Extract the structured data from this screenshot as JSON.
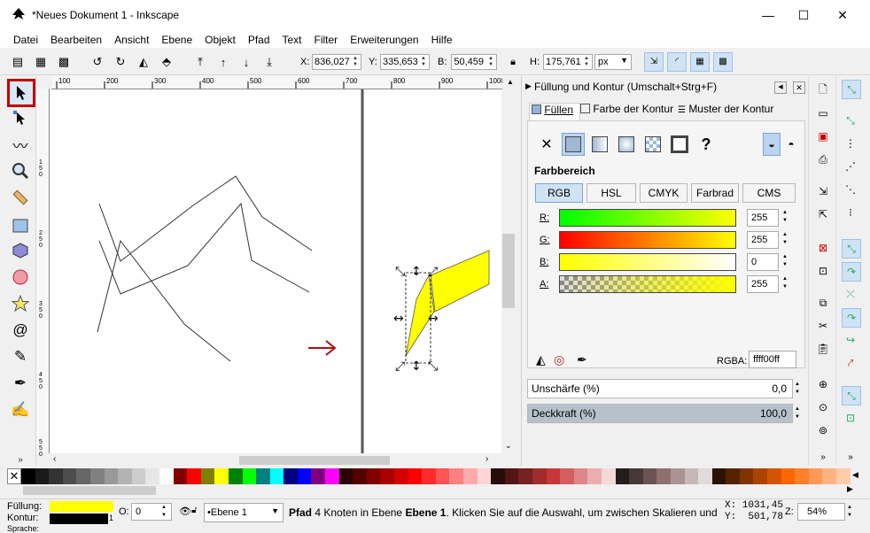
{
  "window": {
    "title": "*Neues Dokument 1 - Inkscape",
    "app_icon": "inkscape-logo-icon",
    "minimize": "—",
    "maximize": "☐",
    "close": "✕"
  },
  "menu": [
    "Datei",
    "Bearbeiten",
    "Ansicht",
    "Ebene",
    "Objekt",
    "Pfad",
    "Text",
    "Filter",
    "Erweiterungen",
    "Hilfe"
  ],
  "toolbar": {
    "x_label": "X:",
    "x_value": "836,027",
    "y_label": "Y:",
    "y_value": "335,653",
    "w_label": "B:",
    "w_value": "50,459",
    "h_label": "H:",
    "h_value": "175,761",
    "unit": "px"
  },
  "tools": [
    "selector-tool-icon",
    "node-tool-icon",
    "tweak-tool-icon",
    "zoom-tool-icon",
    "measure-tool-icon",
    "rect-tool-icon",
    "box3d-tool-icon",
    "ellipse-tool-icon",
    "star-tool-icon",
    "spiral-tool-icon",
    "pencil-tool-icon",
    "pen-tool-icon",
    "calligraphy-tool-icon"
  ],
  "ruler": {
    "h_ticks": [
      "100",
      "200",
      "300",
      "400",
      "500",
      "600",
      "700",
      "800",
      "900",
      "1000"
    ],
    "v_ticks": [
      "1\n5\n0",
      "2\n5\n0",
      "3\n5\n0",
      "4\n5\n0",
      "5\n5\n0"
    ]
  },
  "panel": {
    "title": "Füllung und Kontur (Umschalt+Strg+F)",
    "tabs": [
      "Füllen",
      "Farbe der Kontur",
      "Muster der Kontur"
    ],
    "section": "Farbbereich",
    "modes": [
      "RGB",
      "HSL",
      "CMYK",
      "Farbrad",
      "CMS"
    ],
    "channels": [
      {
        "label": "R:",
        "value": "255"
      },
      {
        "label": "G:",
        "value": "255"
      },
      {
        "label": "B:",
        "value": "0"
      },
      {
        "label": "A:",
        "value": "255"
      }
    ],
    "rgba_label": "RGBA:",
    "rgba_value": "ffff00ff",
    "blur_label": "Unschärfe (%)",
    "blur_value": "0,0",
    "opacity_label": "Deckkraft (%)",
    "opacity_value": "100,0",
    "unset_glyph": "?",
    "none_glyph": "✕"
  },
  "status": {
    "fill_label": "Füllung:",
    "stroke_label": "Kontur:",
    "stroke_width": "1",
    "opacity_label": "O:",
    "opacity_value": "0",
    "layer": "•Ebene 1",
    "message_bold": "Pfad",
    "message_mid": " 4 Knoten in Ebene ",
    "message_layer": "Ebene 1",
    "message_rest": ". Klicken Sie auf die Auswahl, um zwischen Skalieren und Rot",
    "cursor_x": "X: 1031,45",
    "cursor_y": "Y:  501,78",
    "zoom_label": "Z:",
    "zoom_value": "54%",
    "cut_label": "Sprache:"
  },
  "colors": {
    "fill": "#ffff00",
    "stroke": "#000000",
    "arrow": "#aa1111",
    "selected_tool_border": "#c00000"
  },
  "palette": [
    "#000000",
    "#1a1a1a",
    "#333333",
    "#4d4d4d",
    "#666666",
    "#808080",
    "#999999",
    "#b3b3b3",
    "#cccccc",
    "#e6e6e6",
    "#ffffff",
    "#800000",
    "#ff0000",
    "#808000",
    "#ffff00",
    "#008000",
    "#00ff00",
    "#008080",
    "#00ffff",
    "#000080",
    "#0000ff",
    "#800080",
    "#ff00ff",
    "#2b0000",
    "#550000",
    "#800000",
    "#aa0000",
    "#d40000",
    "#ff0000",
    "#ff2a2a",
    "#ff5555",
    "#ff8080",
    "#ffaaaa",
    "#ffd5d5",
    "#280b0b",
    "#501616",
    "#782121",
    "#a02c2c",
    "#c83737",
    "#d35f5f",
    "#de8787",
    "#e9afaf",
    "#f4d7d7",
    "#241c1c",
    "#483737",
    "#6c5353",
    "#916f6f",
    "#ac9393",
    "#c8b7b7",
    "#e3dbdb",
    "#2b1100",
    "#552200",
    "#803300",
    "#aa4400",
    "#d45500",
    "#ff6600",
    "#ff7f2a",
    "#ff9955",
    "#ffb380",
    "#ffccaa"
  ]
}
